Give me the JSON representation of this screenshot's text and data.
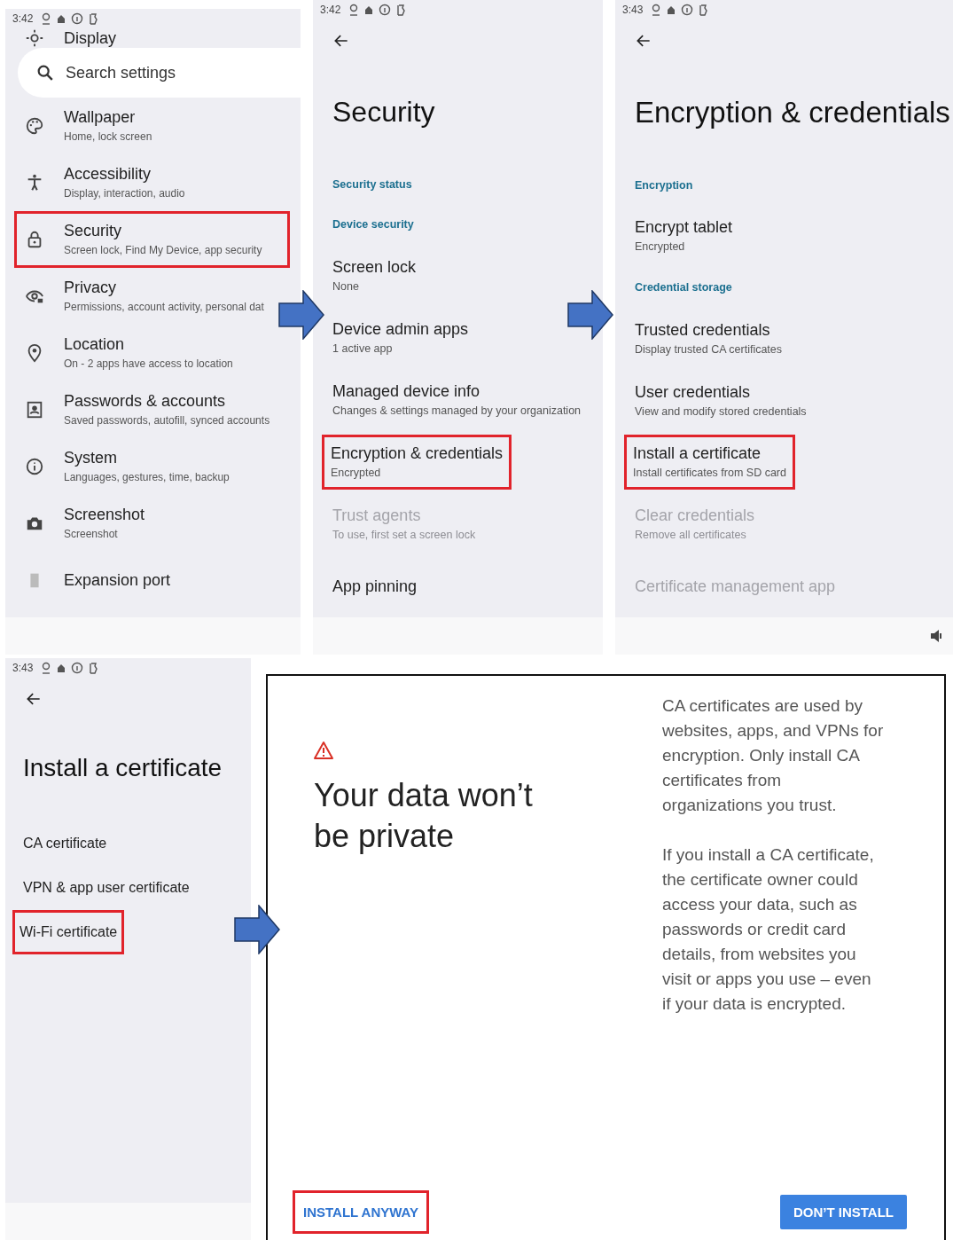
{
  "settings_screen": {
    "status_time": "3:42",
    "search": {
      "placeholder": "Search settings"
    },
    "items": [
      {
        "title": "Display",
        "highlighted": false
      },
      {
        "title": "Wallpaper",
        "subtitle": "Home, lock screen",
        "highlighted": false
      },
      {
        "title": "Accessibility",
        "subtitle": "Display, interaction, audio",
        "highlighted": false
      },
      {
        "title": "Security",
        "subtitle": "Screen lock, Find My Device, app security",
        "highlighted": true
      },
      {
        "title": "Privacy",
        "subtitle": "Permissions, account activity, personal dat",
        "highlighted": false
      },
      {
        "title": "Location",
        "subtitle": "On - 2 apps have access to location",
        "highlighted": false
      },
      {
        "title": "Passwords & accounts",
        "subtitle": "Saved passwords, autofill, synced accounts",
        "highlighted": false
      },
      {
        "title": "System",
        "subtitle": "Languages, gestures, time, backup",
        "highlighted": false
      },
      {
        "title": "Screenshot",
        "subtitle": "Screenshot",
        "highlighted": false
      },
      {
        "title": "Expansion port",
        "highlighted": false
      }
    ]
  },
  "security_screen": {
    "status_time": "3:42",
    "title": "Security",
    "entries": [
      {
        "kind": "category",
        "label": "Security status"
      },
      {
        "kind": "category",
        "label": "Device security"
      },
      {
        "kind": "item",
        "title": "Screen lock",
        "subtitle": "None",
        "disabled": false,
        "highlighted": false
      },
      {
        "kind": "item",
        "title": "Device admin apps",
        "subtitle": "1 active app",
        "disabled": false,
        "highlighted": false
      },
      {
        "kind": "item",
        "title": "Managed device info",
        "subtitle": "Changes & settings managed by your organization",
        "disabled": false,
        "highlighted": false
      },
      {
        "kind": "item",
        "title": "Encryption & credentials",
        "subtitle": "Encrypted",
        "disabled": false,
        "highlighted": true
      },
      {
        "kind": "item",
        "title": "Trust agents",
        "subtitle": "To use, first set a screen lock",
        "disabled": true,
        "highlighted": false
      },
      {
        "kind": "item",
        "title": "App pinning",
        "disabled": false,
        "highlighted": false
      }
    ]
  },
  "encryption_screen": {
    "status_time": "3:43",
    "title": "Encryption & credentials",
    "entries": [
      {
        "kind": "category",
        "label": "Encryption"
      },
      {
        "kind": "item",
        "title": "Encrypt tablet",
        "subtitle": "Encrypted",
        "disabled": false,
        "highlighted": false
      },
      {
        "kind": "category",
        "label": "Credential storage"
      },
      {
        "kind": "item",
        "title": "Trusted credentials",
        "subtitle": "Display trusted CA certificates",
        "disabled": false,
        "highlighted": false
      },
      {
        "kind": "item",
        "title": "User credentials",
        "subtitle": "View and modify stored credentials",
        "disabled": false,
        "highlighted": false
      },
      {
        "kind": "item",
        "title": "Install a certificate",
        "subtitle": "Install certificates from SD card",
        "disabled": false,
        "highlighted": true
      },
      {
        "kind": "item",
        "title": "Clear credentials",
        "subtitle": "Remove all certificates",
        "disabled": true,
        "highlighted": false
      },
      {
        "kind": "item",
        "title": "Certificate management app",
        "disabled": true,
        "highlighted": false
      }
    ]
  },
  "install_certificate_screen": {
    "status_time": "3:43",
    "title": "Install a certificate",
    "items": [
      {
        "title": "CA certificate",
        "highlighted": false
      },
      {
        "title": "VPN & app user certificate",
        "highlighted": false
      },
      {
        "title": "Wi-Fi certificate",
        "highlighted": true
      }
    ]
  },
  "warning_dialog": {
    "title": "Your data won’t be private",
    "paragraphs": [
      "CA certificates are used by websites, apps, and VPNs for encryption. Only install CA certificates from organizations you trust.",
      "If you install a CA certificate, the certificate owner could access your data, such as passwords or credit card details, from websites you visit or apps you use – even if your data is encrypted."
    ],
    "buttons": [
      {
        "kind": "text",
        "label": "INSTALL ANYWAY",
        "highlighted": true
      },
      {
        "kind": "filled",
        "label": "DON’T INSTALL",
        "highlighted": false
      }
    ]
  }
}
